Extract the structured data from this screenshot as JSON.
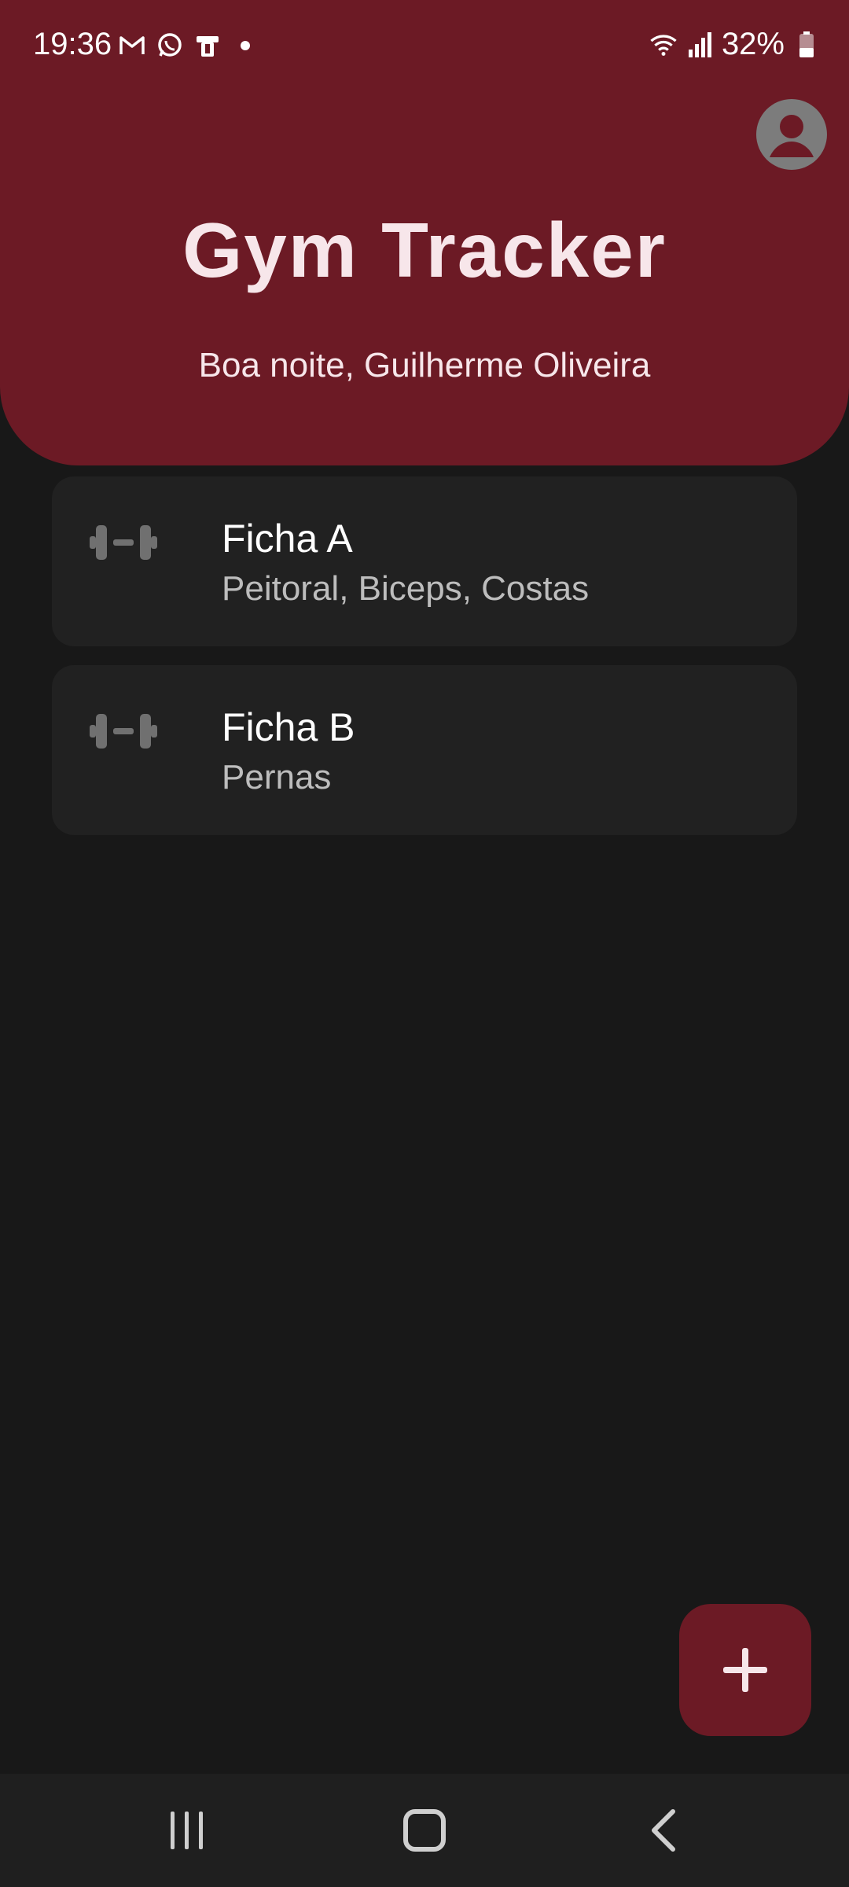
{
  "status_bar": {
    "time": "19:36",
    "battery": "32%",
    "left_icons": [
      "gmail-icon",
      "whatsapp-icon",
      "device-icon"
    ],
    "right_icons": [
      "wifi-icon",
      "signal-icon",
      "battery-icon"
    ]
  },
  "header": {
    "title": "Gym Tracker",
    "greeting": "Boa noite, Guilherme Oliveira"
  },
  "workouts": [
    {
      "title": "Ficha A",
      "subtitle": "Peitoral, Biceps, Costas",
      "icon": "dumbbell-icon"
    },
    {
      "title": "Ficha B",
      "subtitle": "Pernas",
      "icon": "dumbbell-icon"
    }
  ],
  "fab": {
    "icon": "plus-icon"
  },
  "colors": {
    "accent": "#6C1A25",
    "background": "#181818",
    "card": "#212121",
    "title_text": "#F7E6EA"
  }
}
